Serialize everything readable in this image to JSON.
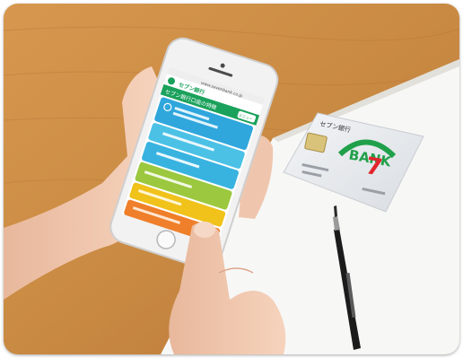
{
  "photo": {
    "subject": "Smartphone with the Seven Bank mobile website and a Seven Bank cash card on a wooden desk",
    "colors": {
      "desk": "#c98a43",
      "paper": "#f7f7f6",
      "phone_frame": "#f2f2f2",
      "site_green": "#1aa15b",
      "menu_blue": "#2fa6dc",
      "menu_cyan": "#4cc1e6",
      "menu_lime": "#9bc83e",
      "menu_yellow": "#f0c21a",
      "menu_orange": "#ef7f2a",
      "card": "#e9ecef",
      "logo_red": "#e1262d",
      "logo_green": "#20a04b",
      "skin": "#f0c8b0"
    }
  },
  "phone_screen": {
    "url": "www.sevenbank.co.jp",
    "brand": "セブン銀行",
    "heading": "セブン銀行口座の特徴",
    "menu_btn": "メニュー"
  },
  "card": {
    "bank_name": "セブン銀行",
    "logo_word": "BANK",
    "logo_digit": "7"
  }
}
